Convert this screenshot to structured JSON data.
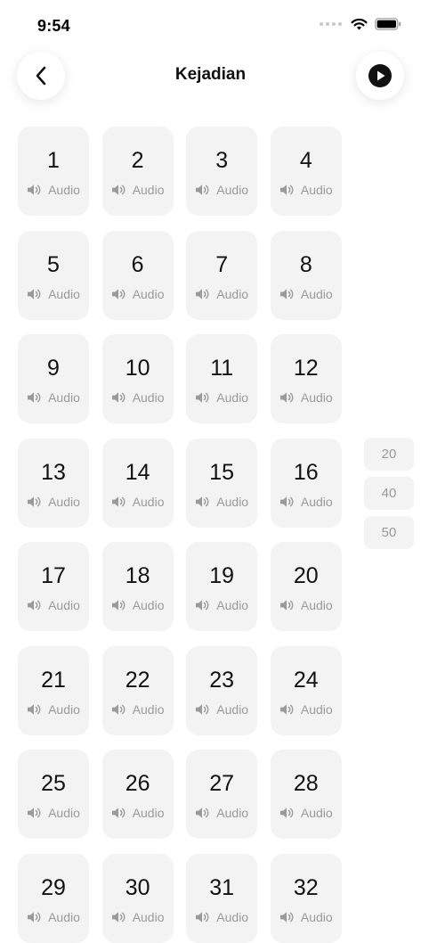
{
  "status_bar": {
    "time": "9:54"
  },
  "header": {
    "title": "Kejadian",
    "back_icon": "chevron-left-icon",
    "play_icon": "play-circle-icon"
  },
  "verses": [
    {
      "number": "1",
      "audio_label": "Audio"
    },
    {
      "number": "2",
      "audio_label": "Audio"
    },
    {
      "number": "3",
      "audio_label": "Audio"
    },
    {
      "number": "4",
      "audio_label": "Audio"
    },
    {
      "number": "5",
      "audio_label": "Audio"
    },
    {
      "number": "6",
      "audio_label": "Audio"
    },
    {
      "number": "7",
      "audio_label": "Audio"
    },
    {
      "number": "8",
      "audio_label": "Audio"
    },
    {
      "number": "9",
      "audio_label": "Audio"
    },
    {
      "number": "10",
      "audio_label": "Audio"
    },
    {
      "number": "11",
      "audio_label": "Audio"
    },
    {
      "number": "12",
      "audio_label": "Audio"
    },
    {
      "number": "13",
      "audio_label": "Audio"
    },
    {
      "number": "14",
      "audio_label": "Audio"
    },
    {
      "number": "15",
      "audio_label": "Audio"
    },
    {
      "number": "16",
      "audio_label": "Audio"
    },
    {
      "number": "17",
      "audio_label": "Audio"
    },
    {
      "number": "18",
      "audio_label": "Audio"
    },
    {
      "number": "19",
      "audio_label": "Audio"
    },
    {
      "number": "20",
      "audio_label": "Audio"
    },
    {
      "number": "21",
      "audio_label": "Audio"
    },
    {
      "number": "22",
      "audio_label": "Audio"
    },
    {
      "number": "23",
      "audio_label": "Audio"
    },
    {
      "number": "24",
      "audio_label": "Audio"
    },
    {
      "number": "25",
      "audio_label": "Audio"
    },
    {
      "number": "26",
      "audio_label": "Audio"
    },
    {
      "number": "27",
      "audio_label": "Audio"
    },
    {
      "number": "28",
      "audio_label": "Audio"
    },
    {
      "number": "29",
      "audio_label": "Audio"
    },
    {
      "number": "30",
      "audio_label": "Audio"
    },
    {
      "number": "31",
      "audio_label": "Audio"
    },
    {
      "number": "32",
      "audio_label": "Audio"
    }
  ],
  "side_index": [
    "20",
    "40",
    "50"
  ],
  "colors": {
    "tile_background": "#f3f3f4",
    "muted_text": "#9a9a9a",
    "primary_text": "#111111"
  }
}
